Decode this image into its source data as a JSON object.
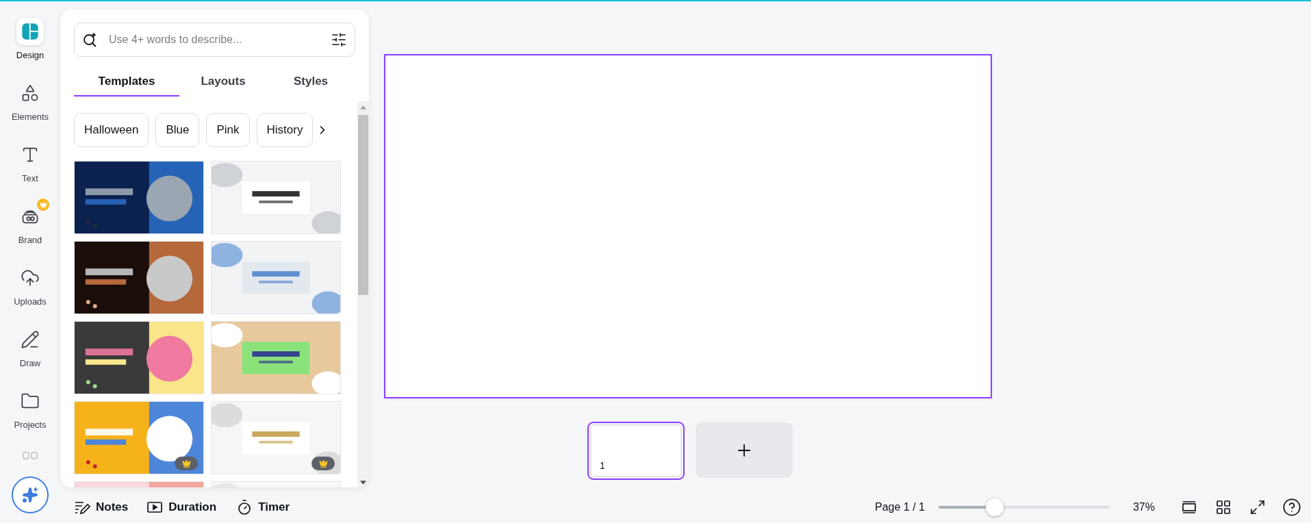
{
  "sidebar": {
    "items": [
      {
        "label": "Design",
        "selected": true,
        "premium": false
      },
      {
        "label": "Elements",
        "selected": false,
        "premium": false
      },
      {
        "label": "Text",
        "selected": false,
        "premium": false
      },
      {
        "label": "Brand",
        "selected": false,
        "premium": true
      },
      {
        "label": "Uploads",
        "selected": false,
        "premium": false
      },
      {
        "label": "Draw",
        "selected": false,
        "premium": false
      },
      {
        "label": "Projects",
        "selected": false,
        "premium": false
      }
    ]
  },
  "panel": {
    "search": {
      "placeholder": "Use 4+ words to describe..."
    },
    "tabs": [
      {
        "label": "Templates",
        "selected": true
      },
      {
        "label": "Layouts",
        "selected": false
      },
      {
        "label": "Styles",
        "selected": false
      }
    ],
    "chips": [
      "Halloween",
      "Blue",
      "Pink",
      "History"
    ],
    "templates": [
      {
        "kind": "picture",
        "premium": false
      },
      {
        "kind": "picture",
        "premium": false
      },
      {
        "kind": "picture",
        "premium": false
      },
      {
        "kind": "picture",
        "premium": false
      },
      {
        "kind": "picture",
        "premium": false
      },
      {
        "kind": "picture",
        "premium": false
      },
      {
        "kind": "picture",
        "premium": true
      },
      {
        "kind": "picture",
        "premium": true
      },
      {
        "kind": "picture",
        "premium": false
      },
      {
        "kind": "picture",
        "premium": false
      }
    ]
  },
  "pages": [
    {
      "number": "1",
      "selected": true
    }
  ],
  "bottom_bar": {
    "notes": "Notes",
    "duration": "Duration",
    "timer": "Timer",
    "page": "Page 1 / 1",
    "zoom": {
      "level": 0.33,
      "reading": "37%"
    }
  }
}
